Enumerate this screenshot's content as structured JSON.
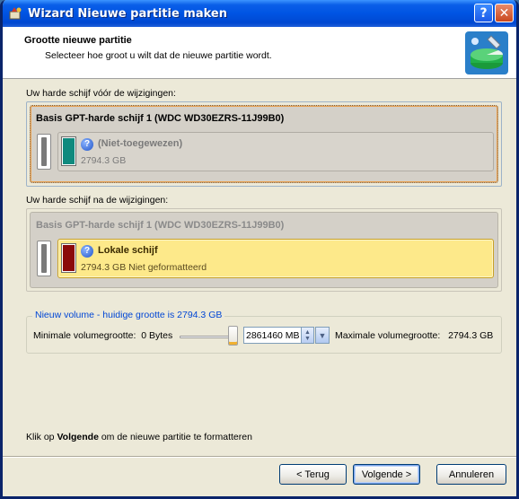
{
  "window": {
    "title": "Wizard Nieuwe partitie maken",
    "help_glyph": "?",
    "close_glyph": "✕"
  },
  "header": {
    "title": "Grootte nieuwe partitie",
    "subtitle": "Selecteer hoe groot u wilt dat de nieuwe partitie wordt."
  },
  "before": {
    "label": "Uw harde schijf vóór de wijzigingen:",
    "disk_name": "Basis GPT-harde schijf 1 (WDC WD30EZRS-11J99B0)",
    "partition_label": "(Niet-toegewezen)",
    "partition_size": "2794.3 GB",
    "partition_color": "#0f8a7e"
  },
  "after": {
    "label": "Uw harde schijf na de wijzigingen:",
    "disk_name": "Basis GPT-harde schijf 1 (WDC WD30EZRS-11J99B0)",
    "partition_label": "Lokale schijf",
    "partition_size": "2794.3 GB Niet geformatteerd",
    "partition_color": "#8b0a0a"
  },
  "volume": {
    "legend": "Nieuw volume - huidige grootte is 2794.3 GB",
    "min_label": "Minimale volumegrootte:",
    "min_value": "0 Bytes",
    "size_value": "2861460 MB",
    "slider_position": 1.0,
    "max_label": "Maximale volumegrootte:",
    "max_value": "2794.3 GB"
  },
  "hint": {
    "prefix": "Klik op ",
    "bold": "Volgende",
    "suffix": " om de nieuwe partitie te formatteren"
  },
  "buttons": {
    "back": "< Terug",
    "next": "Volgende >",
    "cancel": "Annuleren"
  }
}
